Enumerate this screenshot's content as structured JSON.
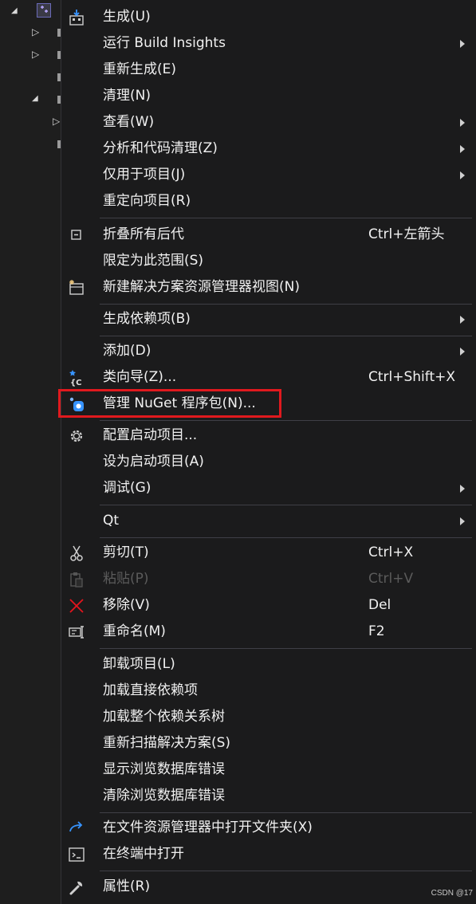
{
  "colors": {
    "menu_bg": "#1b1b1c",
    "text": "#f1f1f1",
    "disabled_text": "#5b5b5b",
    "separator": "#3f3f46",
    "highlight": "#e0191e",
    "accent_blue": "#3794ff",
    "remove_red": "#e5141d"
  },
  "menu": {
    "build": {
      "label": "生成(U)",
      "icon": "build-icon"
    },
    "build_insights": {
      "label": "运行 Build Insights"
    },
    "rebuild": {
      "label": "重新生成(E)"
    },
    "clean": {
      "label": "清理(N)"
    },
    "view": {
      "label": "查看(W)"
    },
    "analyze": {
      "label": "分析和代码清理(Z)"
    },
    "project_only": {
      "label": "仅用于项目(J)"
    },
    "retarget": {
      "label": "重定向项目(R)"
    },
    "collapse_all": {
      "label": "折叠所有后代",
      "shortcut": "Ctrl+左箭头",
      "icon": "collapse-icon"
    },
    "scope_to_this": {
      "label": "限定为此范围(S)"
    },
    "new_view": {
      "label": "新建解决方案资源管理器视图(N)",
      "icon": "new-view-icon"
    },
    "build_dependencies": {
      "label": "生成依赖项(B)"
    },
    "add": {
      "label": "添加(D)"
    },
    "class_wizard": {
      "label": "类向导(Z)...",
      "shortcut": "Ctrl+Shift+X",
      "icon": "class-wizard-icon"
    },
    "manage_nuget": {
      "label": "管理 NuGet 程序包(N)...",
      "icon": "nuget-icon"
    },
    "configure_startup": {
      "label": "配置启动项目...",
      "icon": "gear-icon"
    },
    "set_startup": {
      "label": "设为启动项目(A)"
    },
    "debug": {
      "label": "调试(G)"
    },
    "qt": {
      "label": "Qt"
    },
    "cut": {
      "label": "剪切(T)",
      "shortcut": "Ctrl+X",
      "icon": "scissors-icon"
    },
    "paste": {
      "label": "粘贴(P)",
      "shortcut": "Ctrl+V",
      "icon": "paste-icon"
    },
    "remove": {
      "label": "移除(V)",
      "shortcut": "Del",
      "icon": "close-icon"
    },
    "rename": {
      "label": "重命名(M)",
      "shortcut": "F2",
      "icon": "rename-icon"
    },
    "unload": {
      "label": "卸载项目(L)"
    },
    "load_direct": {
      "label": "加载直接依赖项"
    },
    "load_tree": {
      "label": "加载整个依赖关系树"
    },
    "rescan": {
      "label": "重新扫描解决方案(S)"
    },
    "show_db_errors": {
      "label": "显示浏览数据库错误"
    },
    "clear_db_errors": {
      "label": "清除浏览数据库错误"
    },
    "open_in_explorer": {
      "label": "在文件资源管理器中打开文件夹(X)",
      "icon": "open-folder-arrow-icon"
    },
    "open_in_terminal": {
      "label": "在终端中打开",
      "icon": "terminal-icon"
    },
    "properties": {
      "label": "属性(R)",
      "icon": "wrench-icon"
    }
  },
  "watermark": "CSDN @17"
}
